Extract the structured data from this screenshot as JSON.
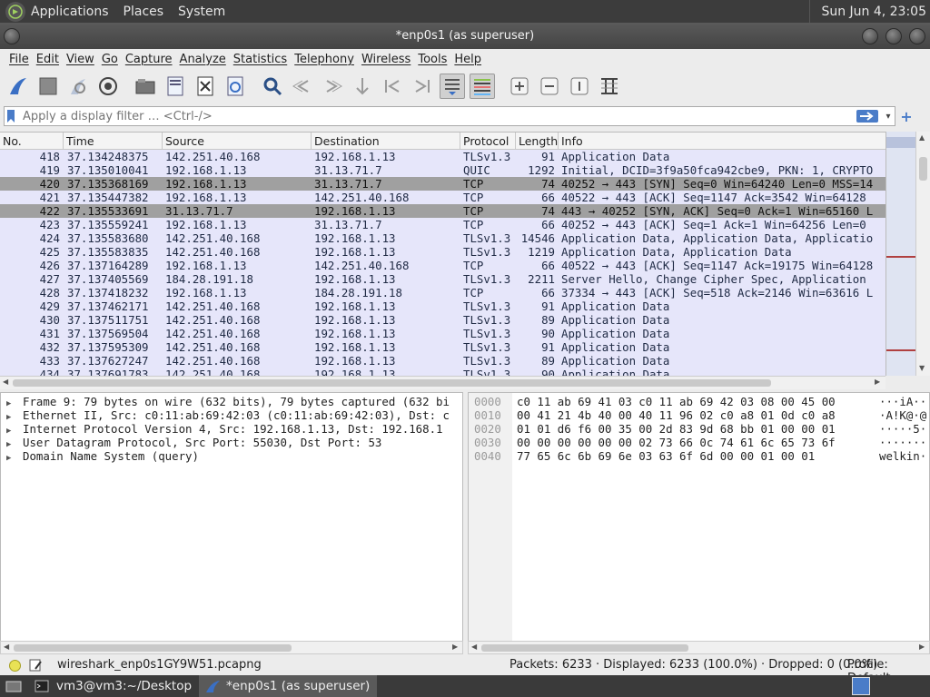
{
  "top_panel": {
    "menus": [
      "Applications",
      "Places",
      "System"
    ],
    "clock": "Sun Jun  4, 23:05"
  },
  "window": {
    "title": "*enp0s1 (as superuser)"
  },
  "menu_bar": [
    "File",
    "Edit",
    "View",
    "Go",
    "Capture",
    "Analyze",
    "Statistics",
    "Telephony",
    "Wireless",
    "Tools",
    "Help"
  ],
  "toolbar": {
    "icons": [
      "shark-fin-start-icon",
      "stop-square-icon",
      "restart-fin-icon",
      "capture-options-gear-icon",
      "open-folder-icon",
      "save-file-icon",
      "close-file-icon",
      "reload-icon",
      "find-magnifier-icon",
      "go-back-icon",
      "go-forward-icon",
      "go-to-packet-icon",
      "first-packet-icon",
      "last-packet-icon",
      "autoscroll-icon",
      "colorize-icon",
      "zoom-in-icon",
      "zoom-out-icon",
      "normal-size-icon",
      "resize-columns-icon"
    ]
  },
  "filter": {
    "placeholder": "Apply a display filter … <Ctrl-/>",
    "value": ""
  },
  "packet_list": {
    "columns": [
      "No.",
      "Time",
      "Source",
      "Destination",
      "Protocol",
      "Length",
      "Info"
    ],
    "rows": [
      {
        "no": "418",
        "time": "37.134248375",
        "src": "142.251.40.168",
        "dst": "192.168.1.13",
        "proto": "TLSv1.3",
        "len": "91",
        "info": "Application Data",
        "style": "lav"
      },
      {
        "no": "419",
        "time": "37.135010041",
        "src": "192.168.1.13",
        "dst": "31.13.71.7",
        "proto": "QUIC",
        "len": "1292",
        "info": "Initial, DCID=3f9a50fca942cbe9, PKN: 1, CRYPTO",
        "style": "lav"
      },
      {
        "no": "420",
        "time": "37.135368169",
        "src": "192.168.1.13",
        "dst": "31.13.71.7",
        "proto": "TCP",
        "len": "74",
        "info": "40252 → 443 [SYN] Seq=0 Win=64240 Len=0 MSS=14",
        "style": "gray"
      },
      {
        "no": "421",
        "time": "37.135447382",
        "src": "192.168.1.13",
        "dst": "142.251.40.168",
        "proto": "TCP",
        "len": "66",
        "info": "40522 → 443 [ACK] Seq=1147 Ack=3542 Win=64128",
        "style": "lav"
      },
      {
        "no": "422",
        "time": "37.135533691",
        "src": "31.13.71.7",
        "dst": "192.168.1.13",
        "proto": "TCP",
        "len": "74",
        "info": "443 → 40252 [SYN, ACK] Seq=0 Ack=1 Win=65160 L",
        "style": "gray"
      },
      {
        "no": "423",
        "time": "37.135559241",
        "src": "192.168.1.13",
        "dst": "31.13.71.7",
        "proto": "TCP",
        "len": "66",
        "info": "40252 → 443 [ACK] Seq=1 Ack=1 Win=64256 Len=0",
        "style": "lav"
      },
      {
        "no": "424",
        "time": "37.135583680",
        "src": "142.251.40.168",
        "dst": "192.168.1.13",
        "proto": "TLSv1.3",
        "len": "14546",
        "info": "Application Data, Application Data, Applicatio",
        "style": "lav"
      },
      {
        "no": "425",
        "time": "37.135583835",
        "src": "142.251.40.168",
        "dst": "192.168.1.13",
        "proto": "TLSv1.3",
        "len": "1219",
        "info": "Application Data, Application Data",
        "style": "lav"
      },
      {
        "no": "426",
        "time": "37.137164289",
        "src": "192.168.1.13",
        "dst": "142.251.40.168",
        "proto": "TCP",
        "len": "66",
        "info": "40522 → 443 [ACK] Seq=1147 Ack=19175 Win=64128",
        "style": "lav"
      },
      {
        "no": "427",
        "time": "37.137405569",
        "src": "184.28.191.18",
        "dst": "192.168.1.13",
        "proto": "TLSv1.3",
        "len": "2211",
        "info": "Server Hello, Change Cipher Spec, Application",
        "style": "lav"
      },
      {
        "no": "428",
        "time": "37.137418232",
        "src": "192.168.1.13",
        "dst": "184.28.191.18",
        "proto": "TCP",
        "len": "66",
        "info": "37334 → 443 [ACK] Seq=518 Ack=2146 Win=63616 L",
        "style": "lav"
      },
      {
        "no": "429",
        "time": "37.137462171",
        "src": "142.251.40.168",
        "dst": "192.168.1.13",
        "proto": "TLSv1.3",
        "len": "91",
        "info": "Application Data",
        "style": "lav"
      },
      {
        "no": "430",
        "time": "37.137511751",
        "src": "142.251.40.168",
        "dst": "192.168.1.13",
        "proto": "TLSv1.3",
        "len": "89",
        "info": "Application Data",
        "style": "lav"
      },
      {
        "no": "431",
        "time": "37.137569504",
        "src": "142.251.40.168",
        "dst": "192.168.1.13",
        "proto": "TLSv1.3",
        "len": "90",
        "info": "Application Data",
        "style": "lav"
      },
      {
        "no": "432",
        "time": "37.137595309",
        "src": "142.251.40.168",
        "dst": "192.168.1.13",
        "proto": "TLSv1.3",
        "len": "91",
        "info": "Application Data",
        "style": "lav"
      },
      {
        "no": "433",
        "time": "37.137627247",
        "src": "142.251.40.168",
        "dst": "192.168.1.13",
        "proto": "TLSv1.3",
        "len": "89",
        "info": "Application Data",
        "style": "lav"
      },
      {
        "no": "434",
        "time": "37.137691783",
        "src": "142.251.40.168",
        "dst": "192.168.1.13",
        "proto": "TLSv1.3",
        "len": "90",
        "info": "Application Data",
        "style": "lav"
      }
    ]
  },
  "details": [
    "Frame 9: 79 bytes on wire (632 bits), 79 bytes captured (632 bi",
    "Ethernet II, Src: c0:11:ab:69:42:03 (c0:11:ab:69:42:03), Dst: c",
    "Internet Protocol Version 4, Src: 192.168.1.13, Dst: 192.168.1",
    "User Datagram Protocol, Src Port: 55030, Dst Port: 53",
    "Domain Name System (query)"
  ],
  "bytes": [
    {
      "offset": "0000",
      "hex": "c0 11 ab 69 41 03 c0 11  ab 69 42 03 08 00 45 00",
      "ascii": "···iA···"
    },
    {
      "offset": "0010",
      "hex": "00 41 21 4b 40 00 40 11  96 02 c0 a8 01 0d c0 a8",
      "ascii": "·A!K@·@"
    },
    {
      "offset": "0020",
      "hex": "01 01 d6 f6 00 35 00 2d  83 9d 68 bb 01 00 00 01",
      "ascii": "·····5·"
    },
    {
      "offset": "0030",
      "hex": "00 00 00 00 00 00 02 73  66 0c 74 61 6c 65 73 6f",
      "ascii": "········"
    },
    {
      "offset": "0040",
      "hex": "77 65 6c 6b 69 6e 03 63  6f 6d 00 00 01 00 01",
      "ascii": "welkin·"
    }
  ],
  "status": {
    "file": "wireshark_enp0s1GY9W51.pcapng",
    "packets": "Packets: 6233 · Displayed: 6233 (100.0%) · Dropped: 0 (0.0%)",
    "profile": "Profile: Default"
  },
  "taskbar": [
    {
      "label": "vm3@vm3:~/Desktop",
      "icon": "terminal-icon",
      "active": false
    },
    {
      "label": "*enp0s1 (as superuser)",
      "icon": "wireshark-icon",
      "active": true
    }
  ],
  "colors": {
    "row_lavender": "#e6e6fa",
    "row_gray": "#a0a0a0",
    "accent_blue": "#4a7cc8",
    "panel_dark": "#3c3c3c"
  }
}
